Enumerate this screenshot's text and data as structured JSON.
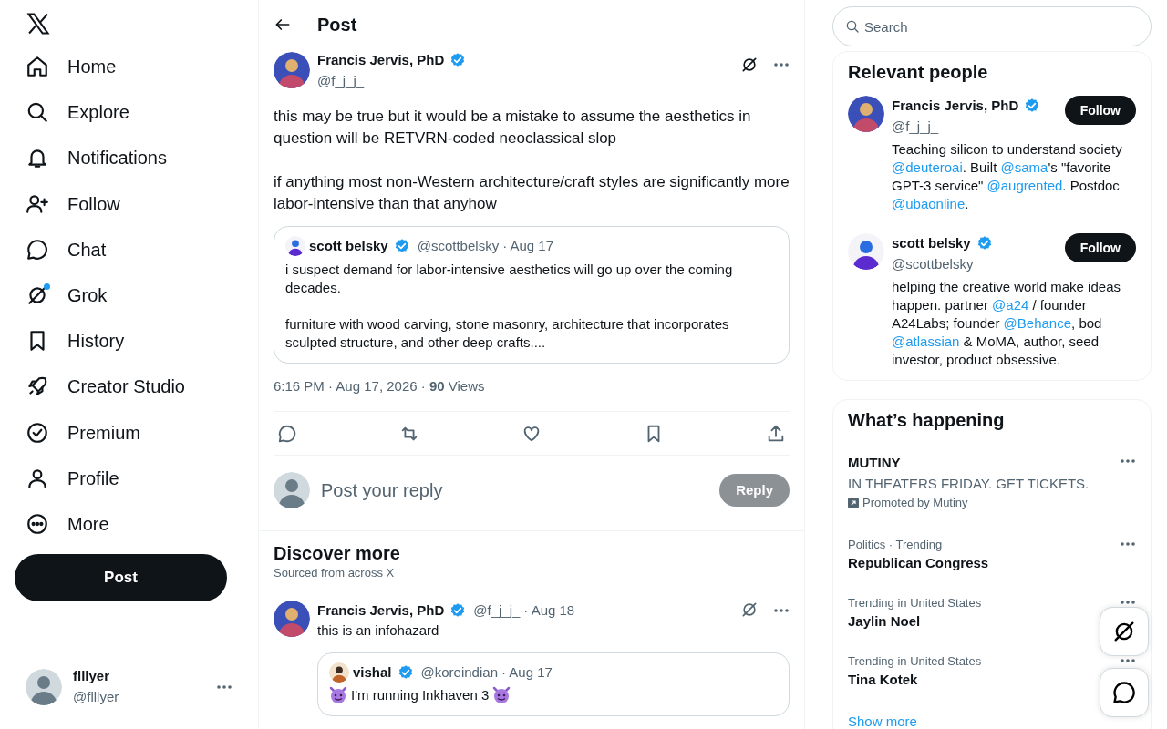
{
  "sidebar": {
    "items": [
      {
        "label": "Home",
        "unread": false
      },
      {
        "label": "Explore",
        "unread": false
      },
      {
        "label": "Notifications",
        "unread": false
      },
      {
        "label": "Follow",
        "unread": false
      },
      {
        "label": "Chat",
        "unread": false
      },
      {
        "label": "Grok",
        "unread": true
      },
      {
        "label": "History",
        "unread": false
      },
      {
        "label": "Creator Studio",
        "unread": false
      },
      {
        "label": "Premium",
        "unread": false
      },
      {
        "label": "Profile",
        "unread": false
      },
      {
        "label": "More",
        "unread": false
      }
    ],
    "post_button": "Post",
    "account": {
      "name": "flllyer",
      "handle": "@flllyer"
    }
  },
  "header": {
    "title": "Post"
  },
  "post": {
    "author": "Francis Jervis, PhD",
    "verified": true,
    "handle": "@f_j_j_",
    "paragraphs": [
      "this may be true but it would be a mistake to assume the aesthetics in question will be RETVRN-coded neoclassical slop",
      "if anything most non-Western architecture/craft styles are significantly more labor-intensive than that anyhow"
    ],
    "quote": {
      "author": "scott belsky",
      "verified": true,
      "handle": "@scottbelsky",
      "date": "· Aug 17",
      "paragraphs": [
        "i suspect demand for labor-intensive aesthetics will go up over the coming decades.",
        "furniture with wood carving, stone masonry, architecture that incorporates sculpted structure, and other deep crafts...."
      ]
    },
    "meta": "6:16 PM · Aug 17, 2026 · **90** Views"
  },
  "reply": {
    "placeholder": "Post your reply",
    "button": "Reply",
    "disabled": true
  },
  "discover": {
    "title": "Discover more",
    "subtitle": "Sourced from across X",
    "posts": [
      {
        "author": "Francis Jervis, PhD",
        "verified": true,
        "handle": "@f_j_j_",
        "date": "· Aug 18",
        "text": "this is an infohazard",
        "quote": {
          "author": "vishal",
          "verified": true,
          "handle": "@koreindian",
          "date": "· Aug 17",
          "headline": "I'm running Inkhaven 3"
        }
      }
    ]
  },
  "search": {
    "placeholder": "Search"
  },
  "relevant_people": {
    "title": "Relevant people",
    "people": [
      {
        "name": "Francis Jervis, PhD",
        "verified": true,
        "handle": "@f_j_j_",
        "button": "Follow",
        "bio": [
          {
            "kind": "text",
            "text": "Teaching silicon to understand society "
          },
          {
            "kind": "mention",
            "text": "@deuteroai"
          },
          {
            "kind": "text",
            "text": ". Built "
          },
          {
            "kind": "mention",
            "text": "@sama"
          },
          {
            "kind": "text",
            "text": "'s \"favorite GPT-3 service\" "
          },
          {
            "kind": "mention",
            "text": "@augrented"
          },
          {
            "kind": "text",
            "text": ". Postdoc "
          },
          {
            "kind": "mention",
            "text": "@ubaonline"
          },
          {
            "kind": "text",
            "text": "."
          }
        ]
      },
      {
        "name": "scott belsky",
        "verified": true,
        "handle": "@scottbelsky",
        "button": "Follow",
        "bio": [
          {
            "kind": "text",
            "text": "helping the creative world make ideas happen. partner "
          },
          {
            "kind": "mention",
            "text": "@a24"
          },
          {
            "kind": "text",
            "text": " / founder A24Labs; founder "
          },
          {
            "kind": "mention",
            "text": "@Behance"
          },
          {
            "kind": "text",
            "text": ", bod "
          },
          {
            "kind": "mention",
            "text": "@atlassian"
          },
          {
            "kind": "text",
            "text": " & MoMA, author, seed investor, product obsessive."
          }
        ]
      }
    ]
  },
  "trends": {
    "title": "What’s happening",
    "items": [
      {
        "kind": "promoted",
        "title": "MUTINY",
        "description": "IN THEATERS FRIDAY. GET TICKETS.",
        "promoted": "Promoted by Mutiny"
      },
      {
        "kind": "trend",
        "context": "Politics · Trending",
        "title": "Republican Congress"
      },
      {
        "kind": "trend",
        "context": "Trending in United States",
        "title": "Jaylin Noel"
      },
      {
        "kind": "trend",
        "context": "Trending in United States",
        "title": "Tina Kotek"
      }
    ],
    "show_more": "Show more"
  }
}
